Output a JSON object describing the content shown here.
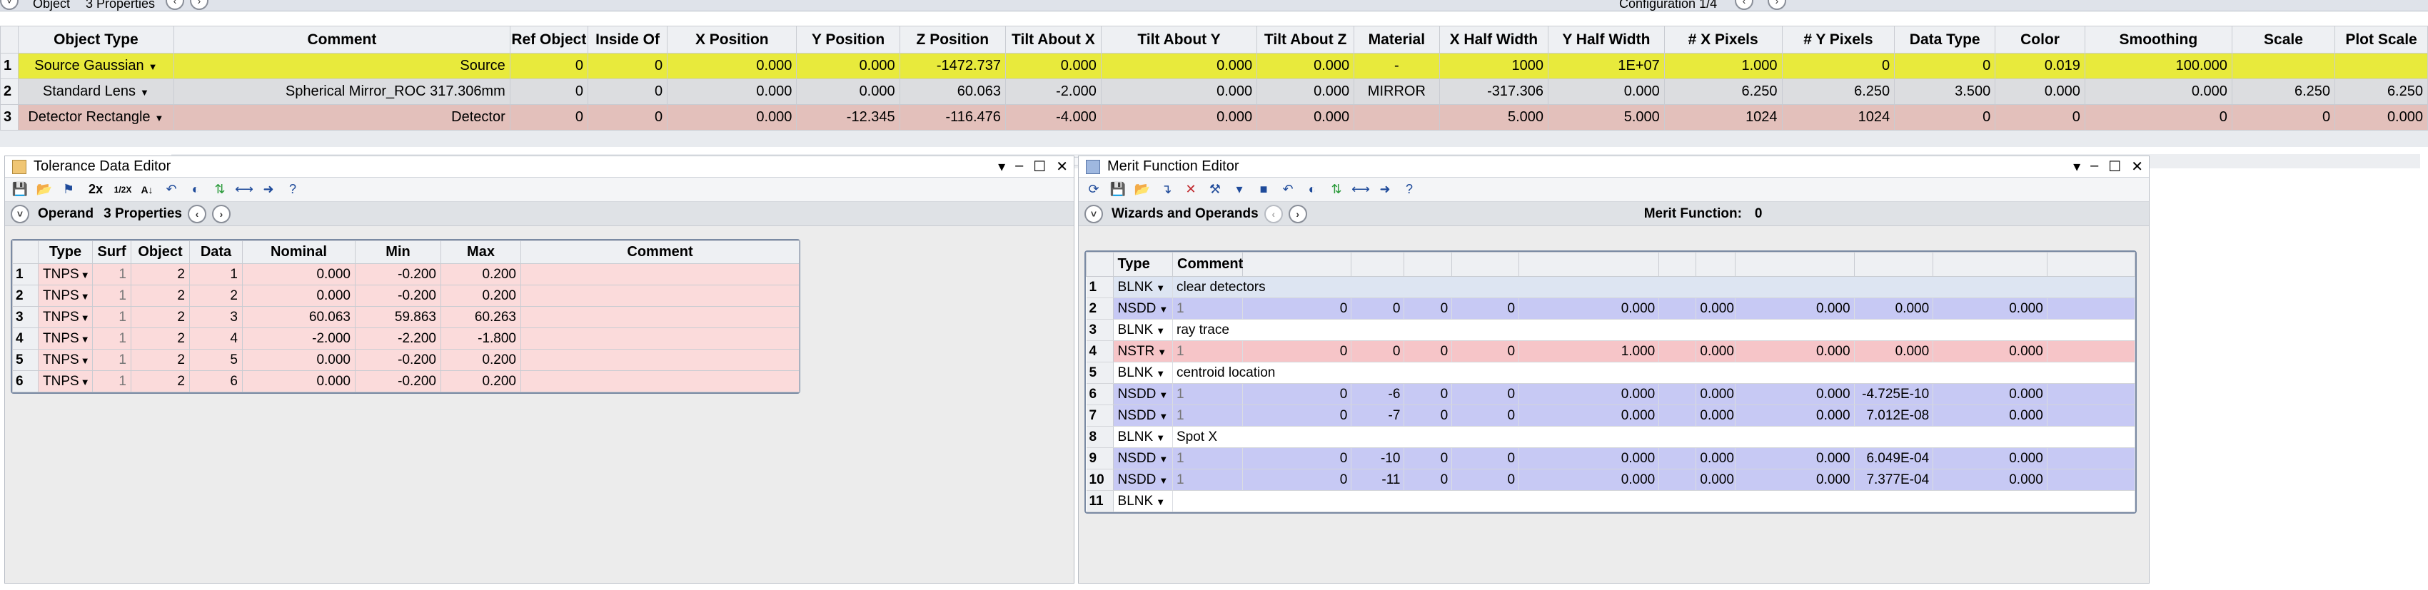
{
  "topbar": {
    "object_label": "Object",
    "properties_label": "3 Properties",
    "configuration_label": "Configuration 1/4"
  },
  "object_editor": {
    "columns": [
      "Object Type",
      "Comment",
      "Ref Object",
      "Inside Of",
      "X Position",
      "Y Position",
      "Z Position",
      "Tilt About X",
      "Tilt About Y",
      "Tilt About Z",
      "Material",
      "X Half Width",
      "Y Half Width",
      "# X Pixels",
      "# Y Pixels",
      "Data Type",
      "Color",
      "Smoothing",
      "Scale",
      "Plot Scale"
    ],
    "rows": [
      {
        "n": "1",
        "type": "Source Gaussian",
        "cells": [
          "Source",
          "0",
          "0",
          "0.000",
          "0.000",
          "-1472.737",
          "0.000",
          "0.000",
          "0.000",
          "-",
          "1000",
          "1E+07",
          "1.000",
          "0",
          "0",
          "0.019",
          "100.000",
          "",
          ""
        ]
      },
      {
        "n": "2",
        "type": "Standard Lens",
        "cells": [
          "Spherical Mirror_ROC 317.306mm",
          "0",
          "0",
          "0.000",
          "0.000",
          "60.063",
          "-2.000",
          "0.000",
          "0.000",
          "MIRROR",
          "-317.306",
          "0.000",
          "6.250",
          "6.250",
          "3.500",
          "0.000",
          "0.000",
          "6.250",
          "6.250"
        ]
      },
      {
        "n": "3",
        "type": "Detector Rectangle",
        "cells": [
          "Detector",
          "0",
          "0",
          "0.000",
          "-12.345",
          "-116.476",
          "-4.000",
          "0.000",
          "0.000",
          "",
          "5.000",
          "5.000",
          "1024",
          "1024",
          "0",
          "0",
          "0",
          "0",
          "0.000"
        ]
      }
    ]
  },
  "tolerance_editor": {
    "title": "Tolerance Data Editor",
    "operand_label": "Operand",
    "properties_label": "3 Properties",
    "columns": [
      "Type",
      "Surf",
      "Object",
      "Data",
      "Nominal",
      "Min",
      "Max",
      "Comment"
    ],
    "rows": [
      {
        "n": "1",
        "type": "TNPS",
        "surf": "1",
        "object": "2",
        "data": "1",
        "nominal": "0.000",
        "min": "-0.200",
        "max": "0.200"
      },
      {
        "n": "2",
        "type": "TNPS",
        "surf": "1",
        "object": "2",
        "data": "2",
        "nominal": "0.000",
        "min": "-0.200",
        "max": "0.200"
      },
      {
        "n": "3",
        "type": "TNPS",
        "surf": "1",
        "object": "2",
        "data": "3",
        "nominal": "60.063",
        "min": "59.863",
        "max": "60.263"
      },
      {
        "n": "4",
        "type": "TNPS",
        "surf": "1",
        "object": "2",
        "data": "4",
        "nominal": "-2.000",
        "min": "-2.200",
        "max": "-1.800"
      },
      {
        "n": "5",
        "type": "TNPS",
        "surf": "1",
        "object": "2",
        "data": "5",
        "nominal": "0.000",
        "min": "-0.200",
        "max": "0.200"
      },
      {
        "n": "6",
        "type": "TNPS",
        "surf": "1",
        "object": "2",
        "data": "6",
        "nominal": "0.000",
        "min": "-0.200",
        "max": "0.200"
      }
    ]
  },
  "merit_editor": {
    "title": "Merit Function Editor",
    "wizards_label": "Wizards and Operands",
    "merit_label": "Merit Function:",
    "merit_value": "0",
    "columns": [
      "Type",
      "Comment"
    ],
    "rows": [
      {
        "n": "1",
        "kind": "sel",
        "type": "BLNK",
        "comment": "clear detectors"
      },
      {
        "n": "2",
        "kind": "nsdd",
        "type": "NSDD",
        "v": [
          "1",
          "0",
          "0",
          "0",
          "0",
          "0.000",
          "",
          "0.000",
          "0.000",
          "0.000",
          "0.000"
        ]
      },
      {
        "n": "3",
        "kind": "blnk",
        "type": "BLNK",
        "comment": "ray trace"
      },
      {
        "n": "4",
        "kind": "nstr",
        "type": "NSTR",
        "v": [
          "1",
          "0",
          "0",
          "0",
          "0",
          "1.000",
          "",
          "0.000",
          "0.000",
          "0.000",
          "0.000"
        ]
      },
      {
        "n": "5",
        "kind": "blnk",
        "type": "BLNK",
        "comment": "centroid location"
      },
      {
        "n": "6",
        "kind": "nsdd",
        "type": "NSDD",
        "v": [
          "1",
          "0",
          "-6",
          "0",
          "0",
          "0.000",
          "",
          "0.000",
          "0.000",
          "-4.725E-10",
          "0.000"
        ]
      },
      {
        "n": "7",
        "kind": "nsdd",
        "type": "NSDD",
        "v": [
          "1",
          "0",
          "-7",
          "0",
          "0",
          "0.000",
          "",
          "0.000",
          "0.000",
          "7.012E-08",
          "0.000"
        ]
      },
      {
        "n": "8",
        "kind": "blnk",
        "type": "BLNK",
        "comment": "Spot X"
      },
      {
        "n": "9",
        "kind": "nsdd",
        "type": "NSDD",
        "v": [
          "1",
          "0",
          "-10",
          "0",
          "0",
          "0.000",
          "",
          "0.000",
          "0.000",
          "6.049E-04",
          "0.000"
        ]
      },
      {
        "n": "10",
        "kind": "nsdd",
        "type": "NSDD",
        "v": [
          "1",
          "0",
          "-11",
          "0",
          "0",
          "0.000",
          "",
          "0.000",
          "0.000",
          "7.377E-04",
          "0.000"
        ]
      },
      {
        "n": "11",
        "kind": "blnk",
        "type": "BLNK",
        "comment": ""
      }
    ]
  }
}
